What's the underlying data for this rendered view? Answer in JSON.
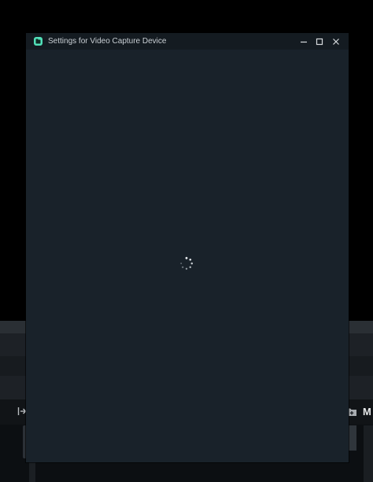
{
  "dialog": {
    "title": "Settings for Video Capture Device",
    "state": "loading",
    "window_controls": [
      "minimize-icon",
      "maximize-icon",
      "close-icon"
    ]
  },
  "background": {
    "right_label": "M"
  },
  "colors": {
    "dialog_bg": "#19222a",
    "titlebar_bg": "#141b21",
    "accent": "#52e0b8",
    "text": "#c9cfd4"
  }
}
